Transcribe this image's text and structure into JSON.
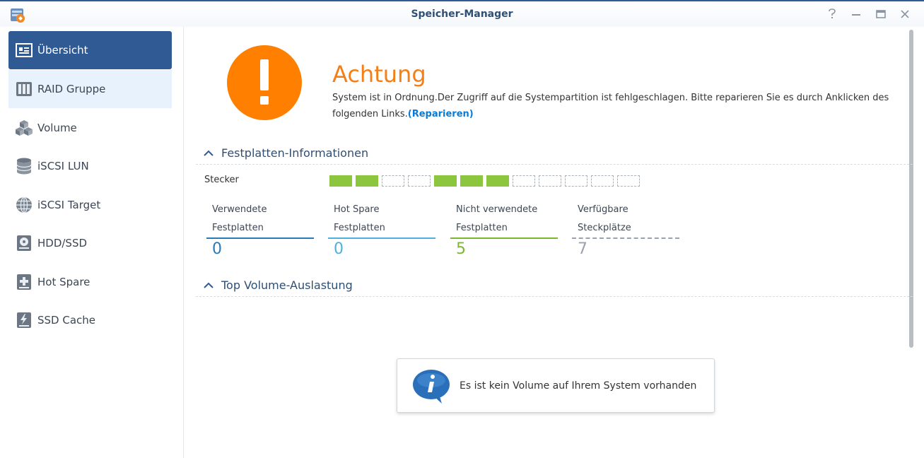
{
  "window": {
    "title": "Speicher-Manager"
  },
  "titlebar_controls": [
    {
      "name": "help",
      "glyph": "?"
    },
    {
      "name": "minimize",
      "glyph": "—"
    },
    {
      "name": "maximize",
      "glyph": "▭"
    },
    {
      "name": "close",
      "glyph": "✕"
    }
  ],
  "sidebar": {
    "items": [
      {
        "label": "Übersicht",
        "icon": "overview-icon",
        "active": true
      },
      {
        "label": "RAID Gruppe",
        "icon": "raid-icon"
      },
      {
        "label": "Volume",
        "icon": "volume-cubes-icon"
      },
      {
        "label": "iSCSI LUN",
        "icon": "database-icon"
      },
      {
        "label": "iSCSI Target",
        "icon": "globe-icon"
      },
      {
        "label": "HDD/SSD",
        "icon": "hdd-icon"
      },
      {
        "label": "Hot Spare",
        "icon": "plus-drive-icon"
      },
      {
        "label": "SSD Cache",
        "icon": "lightning-drive-icon"
      }
    ]
  },
  "status": {
    "heading": "Achtung",
    "message": "System ist in Ordnung.Der Zugriff auf die Systempartition ist fehlgeschlagen. Bitte reparieren Sie es durch Anklicken des folgenden Links.",
    "link": "(Reparieren)",
    "icon": "warning-icon",
    "color": "#ff8000"
  },
  "disk_info": {
    "section_title": "Festplatten-Informationen",
    "stecker_label": "Stecker",
    "slots": [
      true,
      true,
      false,
      false,
      true,
      true,
      true,
      false,
      false,
      false,
      false,
      false
    ],
    "stats": [
      {
        "line1": "Verwendete",
        "line2": "Festplatten",
        "value": "0",
        "color": "#2a7ab8"
      },
      {
        "line1": "",
        "line2": "Hot Spare Festplatten",
        "value": "0",
        "color": "#4fb0e0"
      },
      {
        "line1": "Nicht verwendete",
        "line2": "Festplatten",
        "value": "5",
        "color": "#7cb82f"
      },
      {
        "line1": "Verfügbare",
        "line2": "Steckplätze",
        "value": "7",
        "color": "#9aa3ad"
      }
    ]
  },
  "volume_usage": {
    "section_title": "Top Volume-Auslastung",
    "empty_message": "Es ist kein Volume auf Ihrem System vorhanden",
    "icon": "info-bubble-icon"
  }
}
